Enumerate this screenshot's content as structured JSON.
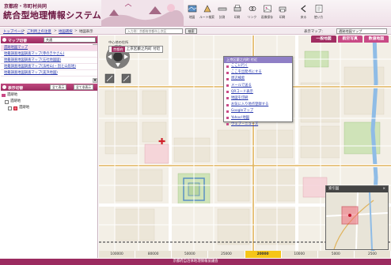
{
  "header": {
    "subtitle": "京都府・市町村共同",
    "title": "統合型地理情報システム(GIS)",
    "toolbar": [
      {
        "label": "地図",
        "icon": "map-icon"
      },
      {
        "label": "ルート検索",
        "icon": "route-icon"
      },
      {
        "label": "計測",
        "icon": "measure-icon"
      },
      {
        "label": "印刷",
        "icon": "print-icon"
      },
      {
        "label": "リンク",
        "icon": "link-icon"
      },
      {
        "label": "画像保存",
        "icon": "image-save-icon"
      },
      {
        "label": "印刷",
        "icon": "print2-icon"
      },
      {
        "label": "戻る",
        "icon": "back-icon"
      },
      {
        "label": "使い方",
        "icon": "help-icon"
      }
    ]
  },
  "nav": {
    "top": "トップページ",
    "sep1": ">",
    "guide": "ご利用上の注意",
    "sep2": ">",
    "map_select": "地図選択",
    "sep3": ">",
    "current": "地図表示",
    "search_placeholder": "入力例：京都府京都市上京区",
    "search_button": "検索",
    "display_map_label": "表示マップ：",
    "display_map_value": "遺跡地図マップ"
  },
  "left": {
    "map_switch": {
      "title": "マップ切替",
      "value": "共通"
    },
    "layers": [
      "遺跡地図マップ",
      "地籍調査地図調査マップ(寺のきやさん)",
      "地籍調査地図調査マップ(五社地図図)",
      "地籍調査地図調査マップ(法村山)・別と山形地)",
      "地籍調査地図調査マップ(美浜地図)"
    ],
    "display_switch": {
      "title": "表示切替",
      "btn_all_on": "全て表示",
      "btn_all_off": "全て非表示"
    },
    "tree": [
      {
        "label": "遺跡地",
        "indent": 0
      },
      {
        "label": "遺跡地",
        "indent": 1
      },
      {
        "label": "遺跡地",
        "indent": 2
      }
    ]
  },
  "map": {
    "tabs": [
      "一般地図",
      "航空写真",
      "数値地図"
    ],
    "active_tab": 0,
    "center_label": "中心地の住所",
    "address_tag": "京都府",
    "address": "上京区藪之内町 付近",
    "context_menu": {
      "title": "上京区藪之内町 付近",
      "items": [
        "ここに行く",
        "ここを出発点にする",
        "周辺検索",
        "メールで送る",
        "QRコード表示",
        "地図を印刷",
        "お気に入り地点登録する",
        "Googleマップ",
        "Yahoo!地図",
        "ウェブ・ニューズ"
      ]
    },
    "overview_title": "索引図",
    "overview_close": "×"
  },
  "scale": {
    "values": [
      "100000",
      "80000",
      "50000",
      "25000",
      "20000",
      "10000",
      "5000",
      "2500"
    ],
    "active_index": 4
  },
  "footer": "京都府自治体地理情報協議会",
  "colors": {
    "brand": "#9b2b60",
    "accent": "#c94a86",
    "link": "#2233aa",
    "active_scale": "#f5c518"
  }
}
